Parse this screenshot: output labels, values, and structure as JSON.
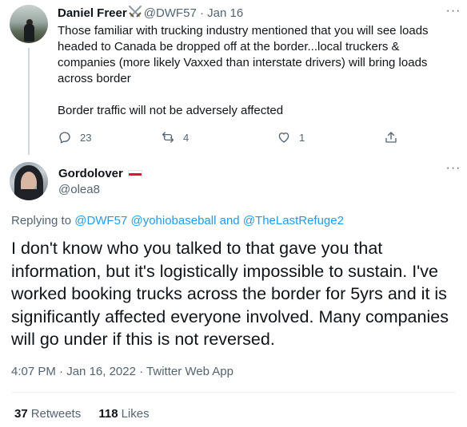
{
  "tweet1": {
    "author_name": "Daniel Freer",
    "author_emoji_icon": "crossed-swords-icon",
    "handle": "@DWF57",
    "separator": "·",
    "date": "Jan 16",
    "text": "Those familiar with trucking industry mentioned that you will see loads headed to Canada be dropped off at the border...local truckers & companies (more likely Vaxxed than interstate drivers) will bring loads across border\n\nBorder traffic will not be adversely affected",
    "reply_count": "23",
    "retweet_count": "4",
    "like_count": "1"
  },
  "tweet2": {
    "author_name": "Gordolover",
    "author_flag_icon": "poland-flag-icon",
    "handle": "@olea8",
    "replying_prefix": "Replying to",
    "replying_to": [
      "@DWF57",
      "@yohiobaseball",
      "@TheLastRefuge2"
    ],
    "replying_and": "and",
    "text": "I don't know who you talked to that gave you that information, but it's logistically impossible to sustain. I've worked booking trucks across the border for 5yrs and it is significantly affected everyone involved. Many companies will go under if this is not reversed.",
    "time": "4:07 PM",
    "date": "Jan 16, 2022",
    "separator": "·",
    "source": "Twitter Web App",
    "retweets_count": "37",
    "retweets_label": "Retweets",
    "likes_count": "118",
    "likes_label": "Likes"
  },
  "colors": {
    "link": "#1d9bf0",
    "muted": "#536471",
    "text": "#0f1419"
  }
}
